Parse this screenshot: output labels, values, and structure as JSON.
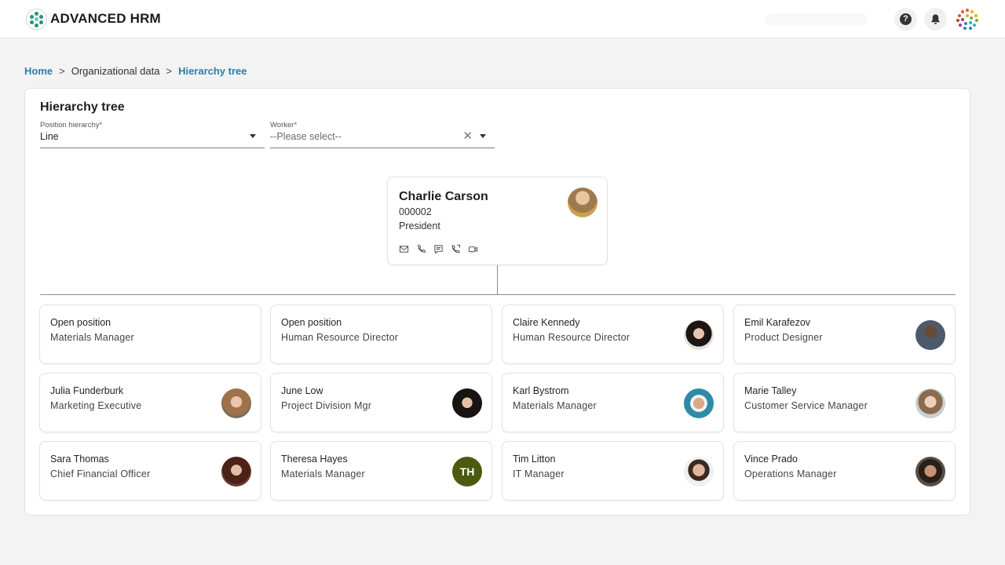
{
  "app": {
    "brand": "ADVANCED HRM"
  },
  "header": {
    "help_icon": "question-mark-icon",
    "notification_icon": "bell-icon"
  },
  "breadcrumb": {
    "home": "Home",
    "section": "Organizational data",
    "current": "Hierarchy tree",
    "separator": ">"
  },
  "page": {
    "title": "Hierarchy tree"
  },
  "filters": {
    "position_hierarchy": {
      "label": "Position hierarchy",
      "required_mark": "*",
      "value": "Line"
    },
    "worker": {
      "label": "Worker",
      "required_mark": "*",
      "placeholder": "--Please select--"
    }
  },
  "root": {
    "name": "Charlie Carson",
    "id": "000002",
    "title": "President",
    "contact_icons": [
      "mail-icon",
      "phone-icon",
      "chat-icon",
      "call-icon",
      "video-icon"
    ]
  },
  "cards": [
    {
      "name": "Open position",
      "role": "Materials Manager"
    },
    {
      "name": "Open position",
      "role": "Human Resource Director"
    },
    {
      "name": "Claire Kennedy",
      "role": "Human Resource Director"
    },
    {
      "name": "Emil Karafezov",
      "role": "Product Designer"
    },
    {
      "name": "Julia Funderburk",
      "role": "Marketing Executive"
    },
    {
      "name": "June Low",
      "role": "Project Division Mgr"
    },
    {
      "name": "Karl Bystrom",
      "role": "Materials Manager"
    },
    {
      "name": "Marie Talley",
      "role": "Customer Service Manager"
    },
    {
      "name": "Sara Thomas",
      "role": "Chief Financial Officer"
    },
    {
      "name": "Theresa Hayes",
      "role": "Materials Manager",
      "initials": "TH"
    },
    {
      "name": "Tim Litton",
      "role": "IT Manager"
    },
    {
      "name": "Vince Prado",
      "role": "Operations Manager"
    }
  ],
  "colors": {
    "link": "#2b7ea6",
    "initials_avatar": "#4b5a0e",
    "required": "#c4314b"
  }
}
